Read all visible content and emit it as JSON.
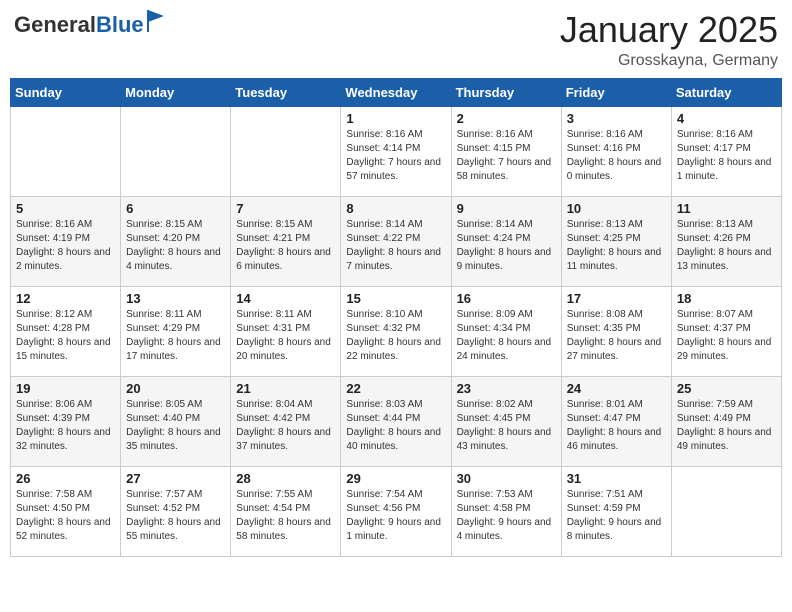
{
  "logo": {
    "general": "General",
    "blue": "Blue"
  },
  "title": "January 2025",
  "location": "Grosskayna, Germany",
  "days_of_week": [
    "Sunday",
    "Monday",
    "Tuesday",
    "Wednesday",
    "Thursday",
    "Friday",
    "Saturday"
  ],
  "weeks": [
    [
      {
        "day": "",
        "info": ""
      },
      {
        "day": "",
        "info": ""
      },
      {
        "day": "",
        "info": ""
      },
      {
        "day": "1",
        "info": "Sunrise: 8:16 AM\nSunset: 4:14 PM\nDaylight: 7 hours and 57 minutes."
      },
      {
        "day": "2",
        "info": "Sunrise: 8:16 AM\nSunset: 4:15 PM\nDaylight: 7 hours and 58 minutes."
      },
      {
        "day": "3",
        "info": "Sunrise: 8:16 AM\nSunset: 4:16 PM\nDaylight: 8 hours and 0 minutes."
      },
      {
        "day": "4",
        "info": "Sunrise: 8:16 AM\nSunset: 4:17 PM\nDaylight: 8 hours and 1 minute."
      }
    ],
    [
      {
        "day": "5",
        "info": "Sunrise: 8:16 AM\nSunset: 4:19 PM\nDaylight: 8 hours and 2 minutes."
      },
      {
        "day": "6",
        "info": "Sunrise: 8:15 AM\nSunset: 4:20 PM\nDaylight: 8 hours and 4 minutes."
      },
      {
        "day": "7",
        "info": "Sunrise: 8:15 AM\nSunset: 4:21 PM\nDaylight: 8 hours and 6 minutes."
      },
      {
        "day": "8",
        "info": "Sunrise: 8:14 AM\nSunset: 4:22 PM\nDaylight: 8 hours and 7 minutes."
      },
      {
        "day": "9",
        "info": "Sunrise: 8:14 AM\nSunset: 4:24 PM\nDaylight: 8 hours and 9 minutes."
      },
      {
        "day": "10",
        "info": "Sunrise: 8:13 AM\nSunset: 4:25 PM\nDaylight: 8 hours and 11 minutes."
      },
      {
        "day": "11",
        "info": "Sunrise: 8:13 AM\nSunset: 4:26 PM\nDaylight: 8 hours and 13 minutes."
      }
    ],
    [
      {
        "day": "12",
        "info": "Sunrise: 8:12 AM\nSunset: 4:28 PM\nDaylight: 8 hours and 15 minutes."
      },
      {
        "day": "13",
        "info": "Sunrise: 8:11 AM\nSunset: 4:29 PM\nDaylight: 8 hours and 17 minutes."
      },
      {
        "day": "14",
        "info": "Sunrise: 8:11 AM\nSunset: 4:31 PM\nDaylight: 8 hours and 20 minutes."
      },
      {
        "day": "15",
        "info": "Sunrise: 8:10 AM\nSunset: 4:32 PM\nDaylight: 8 hours and 22 minutes."
      },
      {
        "day": "16",
        "info": "Sunrise: 8:09 AM\nSunset: 4:34 PM\nDaylight: 8 hours and 24 minutes."
      },
      {
        "day": "17",
        "info": "Sunrise: 8:08 AM\nSunset: 4:35 PM\nDaylight: 8 hours and 27 minutes."
      },
      {
        "day": "18",
        "info": "Sunrise: 8:07 AM\nSunset: 4:37 PM\nDaylight: 8 hours and 29 minutes."
      }
    ],
    [
      {
        "day": "19",
        "info": "Sunrise: 8:06 AM\nSunset: 4:39 PM\nDaylight: 8 hours and 32 minutes."
      },
      {
        "day": "20",
        "info": "Sunrise: 8:05 AM\nSunset: 4:40 PM\nDaylight: 8 hours and 35 minutes."
      },
      {
        "day": "21",
        "info": "Sunrise: 8:04 AM\nSunset: 4:42 PM\nDaylight: 8 hours and 37 minutes."
      },
      {
        "day": "22",
        "info": "Sunrise: 8:03 AM\nSunset: 4:44 PM\nDaylight: 8 hours and 40 minutes."
      },
      {
        "day": "23",
        "info": "Sunrise: 8:02 AM\nSunset: 4:45 PM\nDaylight: 8 hours and 43 minutes."
      },
      {
        "day": "24",
        "info": "Sunrise: 8:01 AM\nSunset: 4:47 PM\nDaylight: 8 hours and 46 minutes."
      },
      {
        "day": "25",
        "info": "Sunrise: 7:59 AM\nSunset: 4:49 PM\nDaylight: 8 hours and 49 minutes."
      }
    ],
    [
      {
        "day": "26",
        "info": "Sunrise: 7:58 AM\nSunset: 4:50 PM\nDaylight: 8 hours and 52 minutes."
      },
      {
        "day": "27",
        "info": "Sunrise: 7:57 AM\nSunset: 4:52 PM\nDaylight: 8 hours and 55 minutes."
      },
      {
        "day": "28",
        "info": "Sunrise: 7:55 AM\nSunset: 4:54 PM\nDaylight: 8 hours and 58 minutes."
      },
      {
        "day": "29",
        "info": "Sunrise: 7:54 AM\nSunset: 4:56 PM\nDaylight: 9 hours and 1 minute."
      },
      {
        "day": "30",
        "info": "Sunrise: 7:53 AM\nSunset: 4:58 PM\nDaylight: 9 hours and 4 minutes."
      },
      {
        "day": "31",
        "info": "Sunrise: 7:51 AM\nSunset: 4:59 PM\nDaylight: 9 hours and 8 minutes."
      },
      {
        "day": "",
        "info": ""
      }
    ]
  ]
}
